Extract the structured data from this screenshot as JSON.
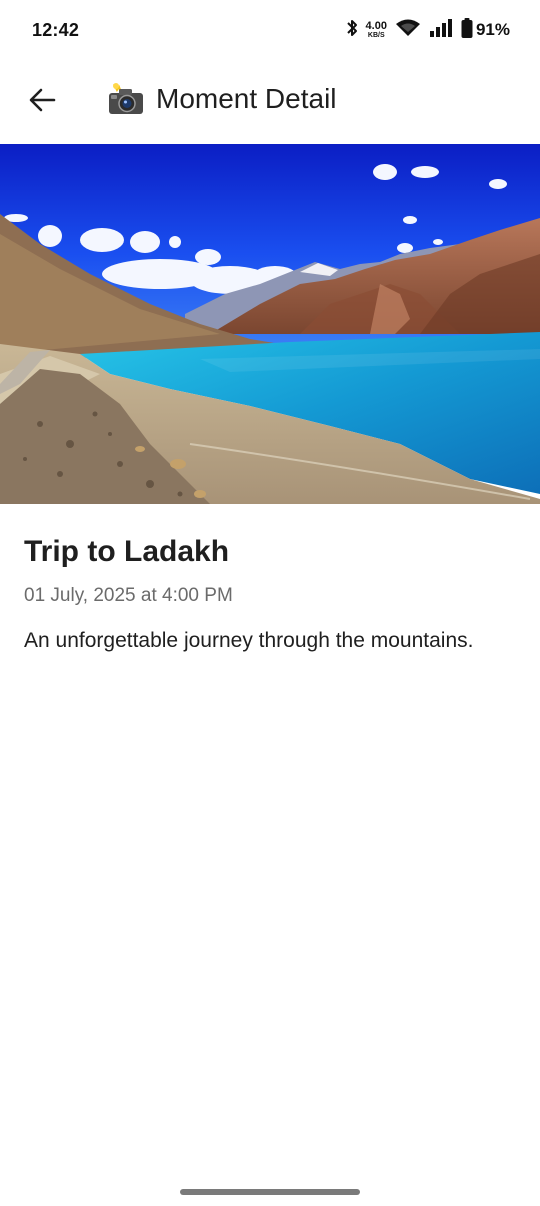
{
  "status_bar": {
    "time": "12:42",
    "net_speed_value": "4.00",
    "net_speed_unit": "KB/S",
    "battery_percent": "91%",
    "icons": [
      "bluetooth-icon",
      "wifi-icon",
      "cell-signal-icon",
      "battery-icon"
    ]
  },
  "app_bar": {
    "back_icon": "arrow-left-icon",
    "title_icon": "camera-with-flash-icon",
    "title": "Moment Detail"
  },
  "moment": {
    "title": "Trip to Ladakh",
    "date": "01 July, 2025 at 4:00 PM",
    "description": "An unforgettable journey through the mountains."
  },
  "colors": {
    "sky": "#1a2fd6",
    "lake": "#1aa3d6",
    "mountains": "#9a5a3c",
    "text_primary": "#1f1f1f",
    "text_secondary": "#6b6b6b"
  }
}
